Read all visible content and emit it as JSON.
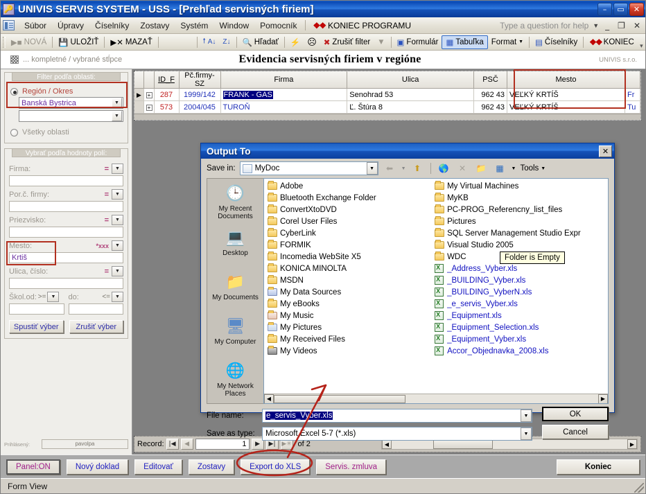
{
  "window": {
    "title_main": "UNIVIS SERVIS SYSTEM",
    "title_sep1": " - ",
    "title_app": "USS",
    "title_sep2": " - ",
    "title_doc": "[Prehľad servisných firiem]",
    "icon": "key-icon",
    "minimize": "–",
    "maximize": "▭",
    "close": "✕"
  },
  "menubar": {
    "app_icon": "access-window-icon",
    "items": [
      {
        "label": "Súbor"
      },
      {
        "label": "Úpravy"
      },
      {
        "label": "Číselníky"
      },
      {
        "label": "Zostavy"
      },
      {
        "label": "Systém"
      },
      {
        "label": "Window"
      },
      {
        "label": "Pomocník"
      }
    ],
    "konec_program": "KONIEC PROGRAMU",
    "help_placeholder": "Type a question for help",
    "win_minimize": "_",
    "win_restore": "❐",
    "win_close": "✕"
  },
  "toolbar": {
    "nova": "NOVÁ",
    "ulozit": "ULOŽIŤ",
    "mazat": "MAZAŤ",
    "sort_asc": "A↓",
    "sort_desc": "Z↓",
    "hladat": "Hľadať",
    "filter_by_form": "filter-lightning-icon",
    "filter_face": "face-icon",
    "zrusit_filter": "Zrušiť filter",
    "filter_funnel": "funnel-icon",
    "formular": "Formulár",
    "tabulka": "Tabuľka",
    "format": "Format",
    "ciselniky": "Číselníky",
    "koniec": "KONIEC"
  },
  "header": {
    "left_note": "... kompletné / vybrané stĺpce",
    "title": "Evidencia servisných firiem v regióne",
    "right_brand": "UNIVIS s.r.o."
  },
  "filter_panel": {
    "area_legend": "Filter podľa oblasti:",
    "radio_region": "Región / Okres",
    "region_value": "Banská Bystrica",
    "region_value2": "",
    "radio_all": "Všetky oblasti",
    "fields_legend": "Vybrať podľa hodnoty polí:",
    "fields": [
      {
        "label": "Firma:",
        "op": "=",
        "value": ""
      },
      {
        "label": "Por.č. firmy:",
        "op": "=",
        "value": ""
      },
      {
        "label": "Priezvisko:",
        "op": "=",
        "value": ""
      },
      {
        "label": "Mesto:",
        "op": "*xxx",
        "value": "Krtiš"
      },
      {
        "label": "Ulica, číslo:",
        "op": "=",
        "value": ""
      }
    ],
    "skol_od_label": "Škol.od:",
    "skol_od_op": ">=",
    "skol_od_value": "",
    "do_label": "do:",
    "do_op": "<=",
    "do_value": "",
    "btn_run": "Spustiť výber",
    "btn_clear": "Zrušiť výber",
    "login_label": "Prihlásený:",
    "login_user": "pavolpa"
  },
  "datasheet": {
    "columns": [
      "",
      "",
      "ID_F",
      "Pč.firmy-SZ",
      "Firma",
      "Ulica",
      "PSČ",
      "Mesto",
      ""
    ],
    "rows": [
      {
        "current": true,
        "expand": "+",
        "id": "287",
        "pc": "1999/142",
        "firma": "FRANK - GAS",
        "firma_selected": true,
        "ulica": "Senohrad  53",
        "psc": "962 43",
        "mesto": "VEĽKÝ KRTÍŠ",
        "last": "Fr"
      },
      {
        "current": false,
        "expand": "+",
        "id": "573",
        "pc": "2004/045",
        "firma": "TUROŇ",
        "firma_selected": false,
        "ulica": "Ľ. Štúra  8",
        "psc": "962 43",
        "mesto": "VEĽKÝ KRTÍŠ",
        "last": "Tu"
      }
    ]
  },
  "record_nav": {
    "label": "Record:",
    "first": "|◀",
    "prev": "◀",
    "value": "1",
    "next": "▶",
    "last": "▶|",
    "new": "▶✳",
    "of": "of  2",
    "scroll_left": "◀",
    "scroll_right": "▶"
  },
  "dialog": {
    "title": "Output To",
    "close": "✕",
    "save_in_label": "Save in:",
    "save_in_value": "MyDoc",
    "toolbar_icons": [
      "back-icon",
      "up-one-level-icon",
      "search-web-icon",
      "delete-icon",
      "new-folder-icon",
      "views-icon"
    ],
    "tools_label": "Tools",
    "places": [
      {
        "label": "My Recent Documents",
        "icon": "recent-documents-icon"
      },
      {
        "label": "Desktop",
        "icon": "desktop-icon"
      },
      {
        "label": "My Documents",
        "icon": "my-documents-icon"
      },
      {
        "label": "My Computer",
        "icon": "my-computer-icon"
      },
      {
        "label": "My Network Places",
        "icon": "network-places-icon"
      }
    ],
    "files_col1": [
      {
        "name": "Adobe",
        "type": "folder"
      },
      {
        "name": "Bluetooth Exchange Folder",
        "type": "folder"
      },
      {
        "name": "ConvertXtoDVD",
        "type": "folder"
      },
      {
        "name": "Corel User Files",
        "type": "folder"
      },
      {
        "name": "CyberLink",
        "type": "folder"
      },
      {
        "name": "FORMIK",
        "type": "folder"
      },
      {
        "name": "Incomedia WebSite X5",
        "type": "folder"
      },
      {
        "name": "KONICA MINOLTA",
        "type": "folder"
      },
      {
        "name": "MSDN",
        "type": "folder"
      },
      {
        "name": "My Data Sources",
        "type": "folder-special"
      },
      {
        "name": "My eBooks",
        "type": "folder"
      },
      {
        "name": "My Music",
        "type": "folder-special"
      },
      {
        "name": "My Pictures",
        "type": "folder-special"
      },
      {
        "name": "My Received Files",
        "type": "folder"
      },
      {
        "name": "My Videos",
        "type": "folder-special"
      }
    ],
    "files_col2": [
      {
        "name": "My Virtual Machines",
        "type": "folder"
      },
      {
        "name": "MyKB",
        "type": "folder"
      },
      {
        "name": "PC-PROG_Referencny_list_files",
        "type": "folder"
      },
      {
        "name": "Pictures",
        "type": "folder"
      },
      {
        "name": "SQL Server Management Studio Expr",
        "type": "folder"
      },
      {
        "name": "Visual Studio 2005",
        "type": "folder"
      },
      {
        "name": "WDC",
        "type": "folder"
      },
      {
        "name": "_Address_Vyber.xls",
        "type": "xls"
      },
      {
        "name": "_BUILDING_Vyber.xls",
        "type": "xls"
      },
      {
        "name": "_BUILDING_VyberN.xls",
        "type": "xls"
      },
      {
        "name": "_e_servis_Vyber.xls",
        "type": "xls"
      },
      {
        "name": "_Equipment.xls",
        "type": "xls"
      },
      {
        "name": "_Equipment_Selection.xls",
        "type": "xls"
      },
      {
        "name": "_Equipment_Vyber.xls",
        "type": "xls"
      },
      {
        "name": "Accor_Objednavka_2008.xls",
        "type": "xls"
      }
    ],
    "tooltip": "Folder is Empty",
    "file_name_label": "File name:",
    "file_name_value": "e_servis_Vyber.xls",
    "save_as_type_label": "Save as type:",
    "save_as_type_value": "Microsoft Excel 5-7 (*.xls)",
    "ok": "OK",
    "cancel": "Cancel"
  },
  "command_bar": {
    "panel": "Panel:ON",
    "novy_doklad": "Nový doklad",
    "editovat": "Editovať",
    "zostavy": "Zostavy",
    "export_xls": "Export do XLS",
    "servis_zmluva": "Servis. zmluva",
    "koniec": "Koniec"
  },
  "status_bar": {
    "text": "Form View"
  },
  "colors": {
    "title_blue": "#0a49b5",
    "annotation_red": "#b5231a",
    "accent_purple": "#6a2fa0",
    "link_blue": "#2030b8",
    "id_red": "#c02020"
  }
}
